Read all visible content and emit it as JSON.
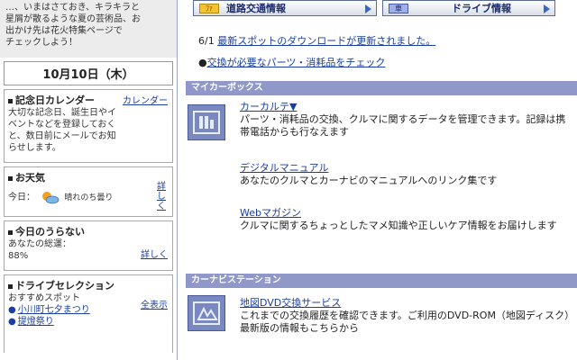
{
  "sidebar": {
    "promo_lines": [
      "…、いまはさておき、キラキラと",
      "星屑が散るような夏の芸術品、お",
      "出かけ先は花火特集ページで",
      "チェックしよう！"
    ],
    "date": "10月10日（木）",
    "calendar": {
      "title": "記念日カレンダー",
      "link": "カレンダー",
      "text_lines": [
        "大切な記念日、誕生日やイ",
        "ベントなどを登録しておく",
        "と、数日前にメールでお知",
        "らせします。"
      ]
    },
    "weather": {
      "title": "お天気",
      "today_label": "今日：",
      "forecast": "晴れのち曇り",
      "link": "詳しく"
    },
    "fortune": {
      "title": "今日のうらない",
      "text": "あなたの総運：",
      "value": "88%",
      "link": "詳しく"
    },
    "drive": {
      "title": "ドライブセレクション",
      "subtitle": "おすすめスポット",
      "link": "全表示",
      "spots": [
        "小川町七夕まつり",
        "提燈祭り"
      ]
    }
  },
  "main": {
    "buttons": [
      {
        "label": "道路交通情報",
        "icon_text": "ﾌｧ"
      },
      {
        "label": "ドライブ情報",
        "icon_text": "車"
      }
    ],
    "news": [
      {
        "prefix": "6/1 ",
        "link": "最新スポットのダウンロードが更新されました。"
      },
      {
        "prefix": "●",
        "link": "交換が必要なパーツ・消耗品をチェック"
      }
    ],
    "mycar": {
      "section_title": "マイカーボックス",
      "items": [
        {
          "title": "カーカルテ▼",
          "desc": "パーツ・消耗品の交換、クルマに関するデータを管理できます。記録は携帯電話からも行なえます"
        },
        {
          "title": "デジタルマニュアル",
          "desc": "あなたのクルマとカーナビのマニュアルへのリンク集です"
        },
        {
          "title": "Webマガジン",
          "desc": "クルマに関するちょっとしたマメ知識や正しいケア情報をお届けします"
        }
      ]
    },
    "navi": {
      "section_title": "カーナビステーション",
      "items": [
        {
          "title": "地図DVD交換サービス",
          "desc": "これまでの交換履歴を確認できます。ご利用のDVD-ROM（地図ディスク）最新版の情報もこちらから"
        }
      ]
    }
  },
  "colors": {
    "section_bar": "#8f98c8",
    "link": "#1a3fa0",
    "button_text": "#1a2a6a"
  }
}
